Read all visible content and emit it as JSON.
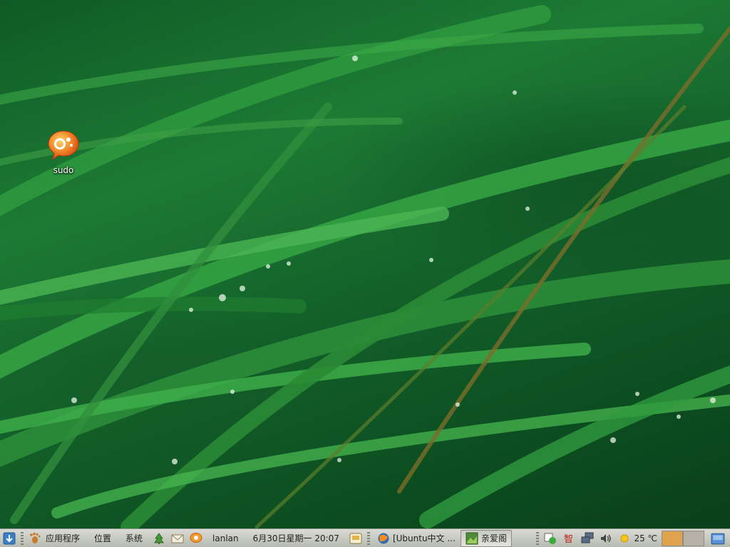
{
  "desktop": {
    "icons": [
      {
        "label": "sudo",
        "icon": "speech-bubble-icon"
      }
    ]
  },
  "panel": {
    "main_menu": {
      "apps_label": "应用程序",
      "places_label": "位置",
      "system_label": "系统"
    },
    "user": "lanlan",
    "clock": "6月30日星期一 20:07",
    "tasks": [
      {
        "label": "[Ubuntu中文 ...",
        "icon": "browser-icon"
      },
      {
        "label": "亲爱阁",
        "icon": "image-viewer-icon"
      }
    ],
    "tray": {
      "weather": "25 ℃"
    },
    "workspaces": [
      {
        "label": "workspace-1",
        "color": "#e0a24a",
        "active": true
      },
      {
        "label": "workspace-2",
        "color": "#b8b1a8",
        "active": false
      }
    ]
  },
  "colors": {
    "panel_bg": "#c5c8bf",
    "grass_dark": "#0c4d20",
    "grass_light": "#4fbf55"
  }
}
